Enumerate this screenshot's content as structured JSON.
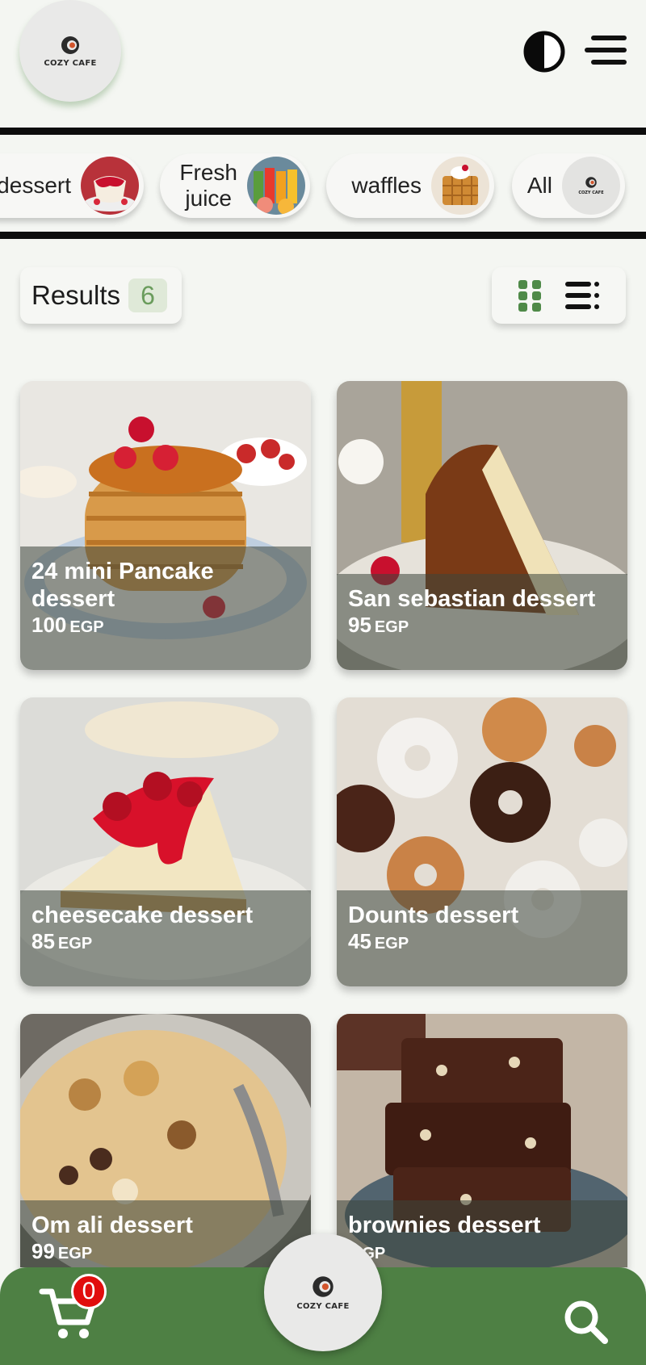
{
  "app": {
    "logo_text": "COZY CAFE"
  },
  "header": {
    "theme_toggle": "contrast-icon",
    "menu": "hamburger-icon"
  },
  "categories": [
    {
      "label": "dessert",
      "image": "panna-cotta"
    },
    {
      "label_line1": "Fresh",
      "label_line2": "juice",
      "image": "juice-glasses"
    },
    {
      "label": "waffles",
      "image": "waffle-stack"
    },
    {
      "label": "All",
      "logo_text": "COZY CAFE"
    }
  ],
  "results": {
    "label": "Results",
    "count": "6"
  },
  "view_toggle": {
    "grid": "grid-view-icon",
    "list": "list-view-icon"
  },
  "products": [
    {
      "name": "24 mini Pancake dessert",
      "price": "100",
      "currency": "EGP"
    },
    {
      "name": "San sebastian dessert",
      "price": "95",
      "currency": "EGP"
    },
    {
      "name": "cheesecake dessert",
      "price": "85",
      "currency": "EGP"
    },
    {
      "name": "Dounts dessert",
      "price": "45",
      "currency": "EGP"
    },
    {
      "name": "Om ali dessert",
      "price": "99",
      "currency": "EGP"
    },
    {
      "name": "brownies dessert",
      "price": "",
      "currency": "EGP"
    }
  ],
  "bottom_nav": {
    "cart_count": "0",
    "logo_text": "COZY CAFE",
    "search": "search-icon"
  },
  "colors": {
    "brand_green": "#4e8044",
    "badge_red": "#e10d0d",
    "background": "#f4f6f2"
  }
}
